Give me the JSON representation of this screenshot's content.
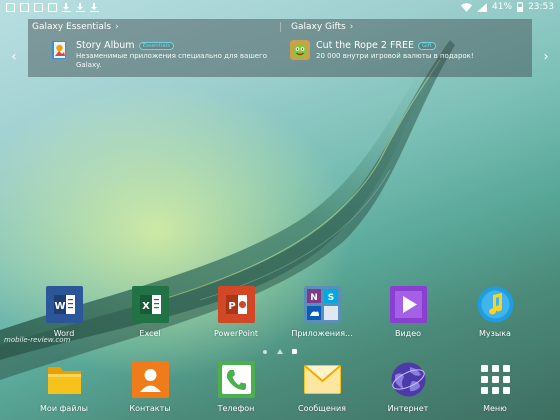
{
  "status_bar": {
    "battery": "41%",
    "time": "23:53",
    "left_icons": [
      "gallery-icon",
      "gallery-icon",
      "gallery-icon",
      "image-icon",
      "download-icon",
      "download-icon",
      "download-icon"
    ],
    "right_icons": [
      "wifi-icon",
      "signal-icon",
      "battery-icon"
    ]
  },
  "promo": {
    "left": {
      "header": "Galaxy Essentials",
      "title": "Story Album",
      "badge": "Essentials",
      "desc": "Незаменимые приложения специально для вашего Galaxy."
    },
    "right": {
      "header": "Galaxy Gifts",
      "title": "Cut the Rope 2 FREE",
      "badge": "Gift",
      "desc": "20 000 внутри игровой валюты в подарок!"
    },
    "prev_symbol": "‹",
    "next_symbol": "›",
    "chevron": "›"
  },
  "apps_row1": [
    {
      "label": "Word",
      "icon": "word-icon"
    },
    {
      "label": "Excel",
      "icon": "excel-icon"
    },
    {
      "label": "PowerPoint",
      "icon": "powerpoint-icon"
    },
    {
      "label": "Приложения...",
      "icon": "ms-apps-folder-icon"
    },
    {
      "label": "Видео",
      "icon": "video-icon"
    },
    {
      "label": "Музыка",
      "icon": "music-icon"
    }
  ],
  "apps_row2": [
    {
      "label": "Мои файлы",
      "icon": "folder-icon"
    },
    {
      "label": "Контакты",
      "icon": "contacts-icon"
    },
    {
      "label": "Телефон",
      "icon": "phone-icon"
    },
    {
      "label": "Сообщения",
      "icon": "messages-icon"
    },
    {
      "label": "Интернет",
      "icon": "internet-icon"
    },
    {
      "label": "Меню",
      "icon": "apps-grid-icon"
    }
  ],
  "watermark": "mobile-review.com",
  "colors": {
    "word": "#2b579a",
    "excel": "#217346",
    "powerpoint": "#d24726",
    "video": "#8a3fd0",
    "music": "#1e9de0",
    "folder": "#f4b400",
    "contacts": "#f07b1a",
    "phone": "#4caf50",
    "messages": "#f7c31d",
    "internet": "#4b3aa7"
  }
}
